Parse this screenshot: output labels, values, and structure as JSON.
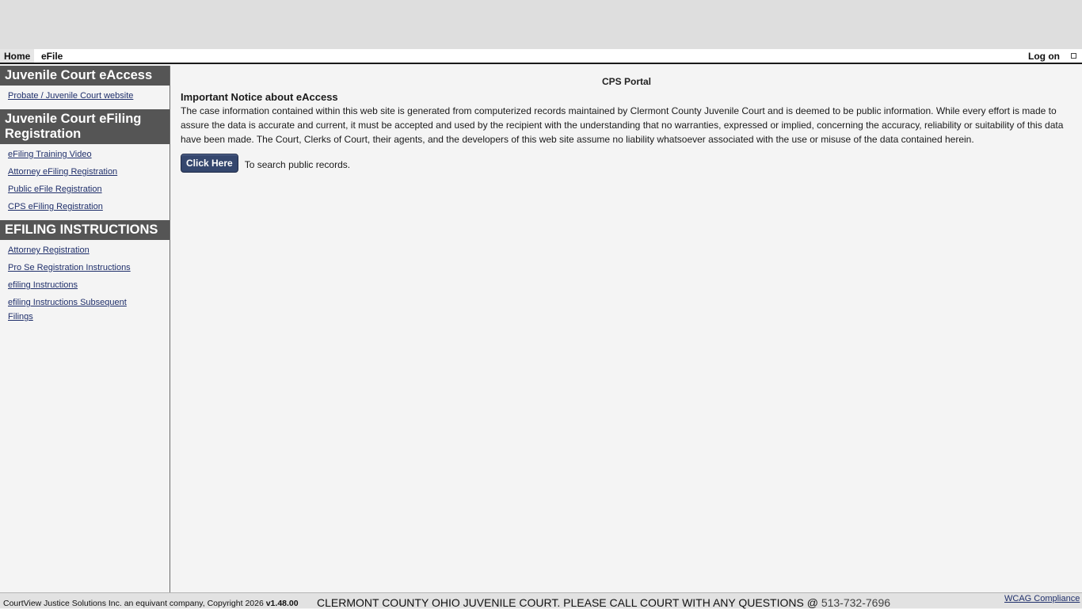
{
  "topnav": {
    "home": "Home",
    "efile": "eFile",
    "logon": "Log on"
  },
  "sidebar": {
    "sections": [
      {
        "heading": "Juvenile Court eAccess",
        "links": [
          "Probate / Juvenile Court website"
        ]
      },
      {
        "heading": "Juvenile Court eFiling Registration",
        "links": [
          "eFiling Training Video",
          "Attorney eFiling Registration",
          "Public eFile Registration",
          "CPS eFiling Registration"
        ]
      },
      {
        "heading": "EFILING INSTRUCTIONS",
        "links": [
          "Attorney Registration",
          "Pro Se Registration Instructions",
          "efiling Instructions",
          "efiling Instructions Subsequent Filings"
        ]
      }
    ]
  },
  "main": {
    "portal_title": "CPS Portal",
    "notice_title": "Important Notice about eAccess",
    "notice_body": "The case information contained within this web site is generated from computerized records maintained by Clermont County Juvenile Court and is deemed to be public information. While every effort is made to assure the data is accurate and current, it must be accepted and used by the recipient with the understanding that no warranties, expressed or implied, concerning the accuracy, reliability or suitability of this data have been made. The Court, Clerks of Court, their agents, and the developers of this web site assume no liability whatsoever associated with the use or misuse of the data contained herein.",
    "button_label": "Click Here",
    "button_caption": "To search public records."
  },
  "footer": {
    "copyright": "CourtView Justice Solutions Inc. an equivant company, Copyright 2026",
    "version": "v1.48.00",
    "court_message": "CLERMONT COUNTY OHIO JUVENILE COURT. PLEASE CALL COURT WITH ANY QUESTIONS @",
    "phone": "513-732-7696",
    "wcag": "WCAG Compliance"
  },
  "colors": {
    "sidebar_heading_bg": "#555555",
    "button_bg": "#35476e",
    "link": "#1f2f6b"
  }
}
